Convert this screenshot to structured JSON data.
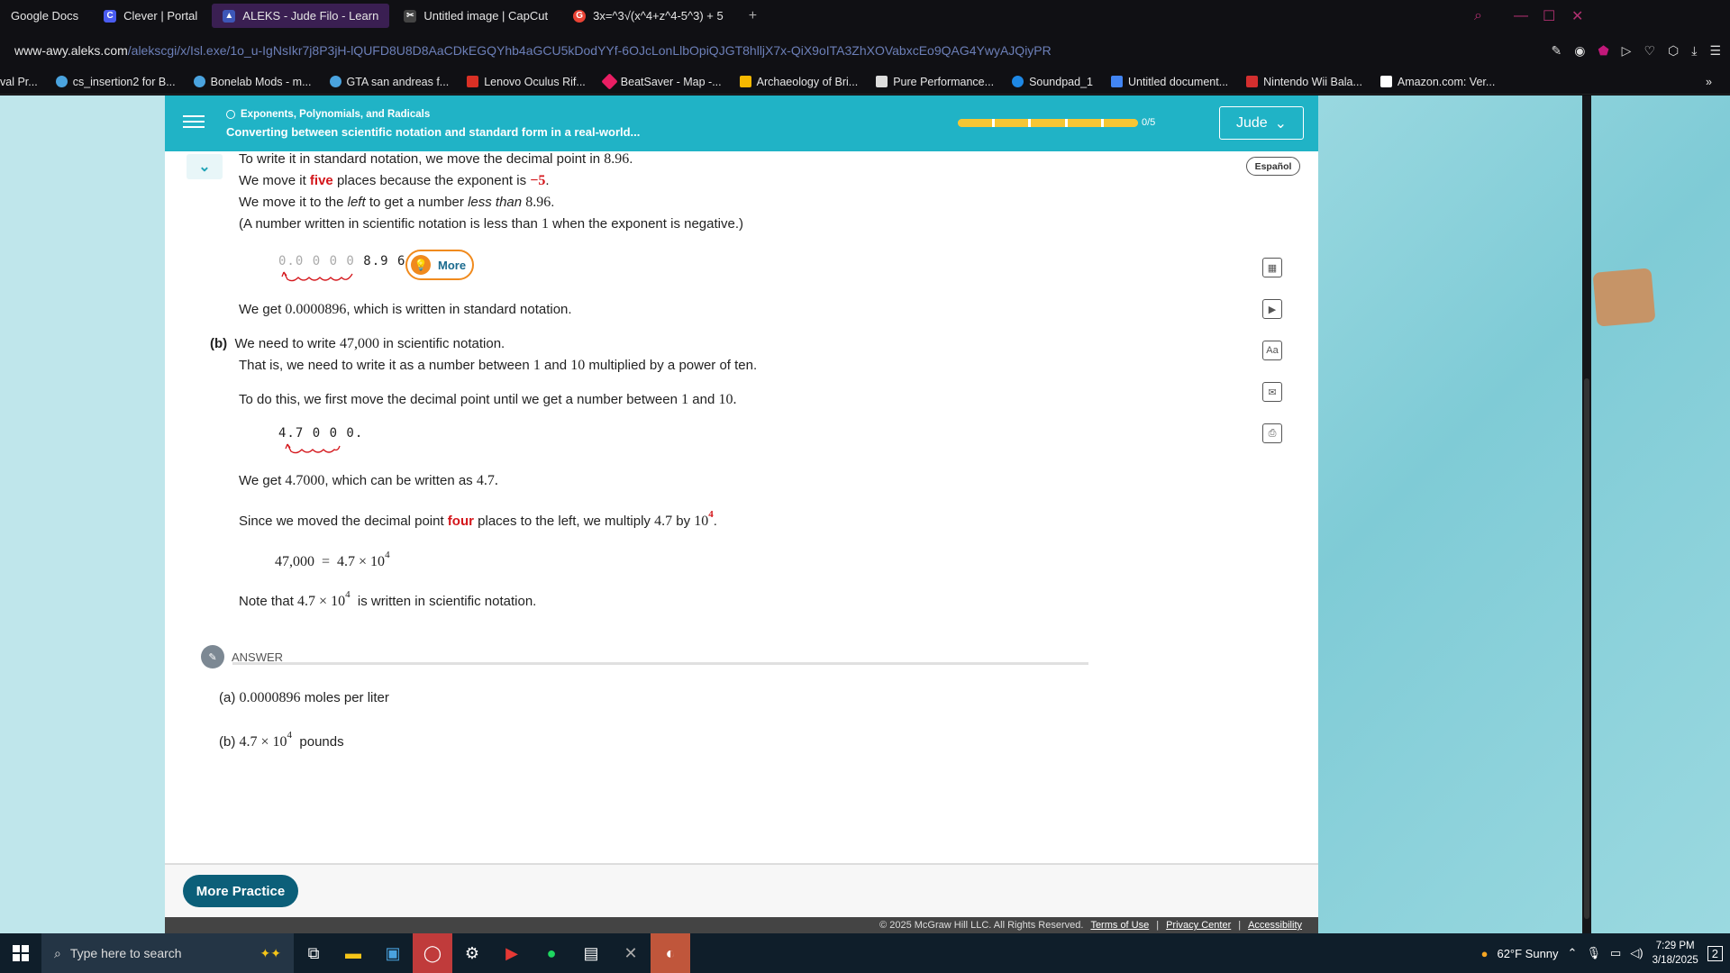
{
  "browser": {
    "tabs": [
      {
        "label": "Google Docs",
        "color": "#1a73e8"
      },
      {
        "label": "Clever | Portal",
        "color": "#4a5cf0"
      },
      {
        "label": "ALEKS - Jude Filo - Learn",
        "color": "#3d57b8"
      },
      {
        "label": "Untitled image | CapCut",
        "color": "#444"
      },
      {
        "label": "3x=^3√(x^4+z^4-5^3) + 5",
        "color": "#ea4335"
      }
    ],
    "url_host": "www-awy.aleks.com",
    "url_path": "/alekscgi/x/Isl.exe/1o_u-IgNsIkr7j8P3jH-lQUFD8U8D8AaCDkEGQYhb4aGCU5kDodYYf-6OJcLonLlbOpiQJGT8hlljX7x-QiX9oITA3ZhXOVabxcEo9QAG4YwyAJQiyPR",
    "bookmarks": [
      {
        "label": "val Pr...",
        "color": "#555"
      },
      {
        "label": "cs_insertion2 for B...",
        "color": "#4aa3df"
      },
      {
        "label": "Bonelab Mods - m...",
        "color": "#4aa3df"
      },
      {
        "label": "GTA san andreas f...",
        "color": "#4aa3df"
      },
      {
        "label": "Lenovo Oculus Rif...",
        "color": "#d93025"
      },
      {
        "label": "BeatSaver - Map -...",
        "color": "#e91e63"
      },
      {
        "label": "Archaeology of Bri...",
        "color": "#f5b800"
      },
      {
        "label": "Pure Performance...",
        "color": "#ddd"
      },
      {
        "label": "Soundpad_1",
        "color": "#1e88e5"
      },
      {
        "label": "Untitled document...",
        "color": "#4285f4"
      },
      {
        "label": "Nintendo Wii Bala...",
        "color": "#d32f2f"
      },
      {
        "label": "Amazon.com: Ver...",
        "color": "#fff"
      }
    ]
  },
  "header": {
    "topic": "Exponents, Polynomials, and Radicals",
    "subtitle": "Converting between scientific notation and standard form in a real-world...",
    "progress": "0/5",
    "progress_fraction": 0,
    "user": "Jude",
    "espanol": "Español"
  },
  "content": {
    "a1": "To write it in standard notation, we move the decimal point in",
    "a1n": "8.96",
    "a2_pre": "We move it",
    "a2_red": "five",
    "a2_mid": "places because the exponent is",
    "a2_exp": "−5",
    "a3_pre": "We move it to the",
    "a3_left": "left",
    "a3_mid": "to get a number",
    "a3_less": "less than",
    "a3_num": "8.96",
    "a4": "(A number written in scientific notation is less than",
    "a4_one": "1",
    "a4_end": "when the exponent is negative.)",
    "digits_a_gray": "0.0 0 0 0",
    "digits_a": "8.9 6",
    "more_label": "More",
    "a5_pre": "We get",
    "a5_num": "0.0000896",
    "a5_end": ", which is written in standard notation.",
    "b_label": "(b)",
    "b1_pre": "We need to write",
    "b1_num": "47,000",
    "b1_end": "in scientific notation.",
    "b2_pre": "That is, we need to write it as a number between",
    "b2_one": "1",
    "b2_and": "and",
    "b2_ten": "10",
    "b2_end": "multiplied by a power of ten.",
    "b3_pre": "To do this, we first move the decimal point until we get a number between",
    "b3_one": "1",
    "b3_and": "and",
    "b3_ten": "10.",
    "digits_b": "4.7 0 0 0.",
    "b4_pre": "We get",
    "b4_num": "4.7000",
    "b4_mid": ", which can be written as",
    "b4_num2": "4.7.",
    "b5_pre": "Since we moved the decimal point",
    "b5_red": "four",
    "b5_mid": "places to the left, we multiply",
    "b5_num": "4.7",
    "b5_by": "by",
    "b5_ten": "10",
    "b5_exp": "4",
    "eq_left": "47,000",
    "eq_eq": "=",
    "eq_right": "4.7 × 10",
    "eq_exp": "4",
    "b6_pre": "Note that",
    "b6_num": "4.7 × 10",
    "b6_exp": "4",
    "b6_end": "is written in scientific notation.",
    "answer_label": "ANSWER",
    "ans_a_pre": "(a)",
    "ans_a_num": "0.0000896",
    "ans_a_end": "moles per liter",
    "ans_b_pre": "(b)",
    "ans_b_num": "4.7 × 10",
    "ans_b_exp": "4",
    "ans_b_end": "pounds"
  },
  "footer": {
    "more_practice": "More Practice",
    "copyright": "© 2025 McGraw Hill LLC. All Rights Reserved.",
    "terms": "Terms of Use",
    "privacy": "Privacy Center",
    "access": "Accessibility"
  },
  "taskbar": {
    "search_placeholder": "Type here to search",
    "weather": "62°F  Sunny",
    "time": "7:29 PM",
    "date": "3/18/2025",
    "notif": "2"
  },
  "icons": [
    "search-icon",
    "calculator-icon",
    "video-icon",
    "dictionary-icon",
    "mail-icon",
    "print-icon",
    "menu-icon",
    "chevron-down-icon",
    "lightbulb-icon",
    "answer-icon"
  ]
}
